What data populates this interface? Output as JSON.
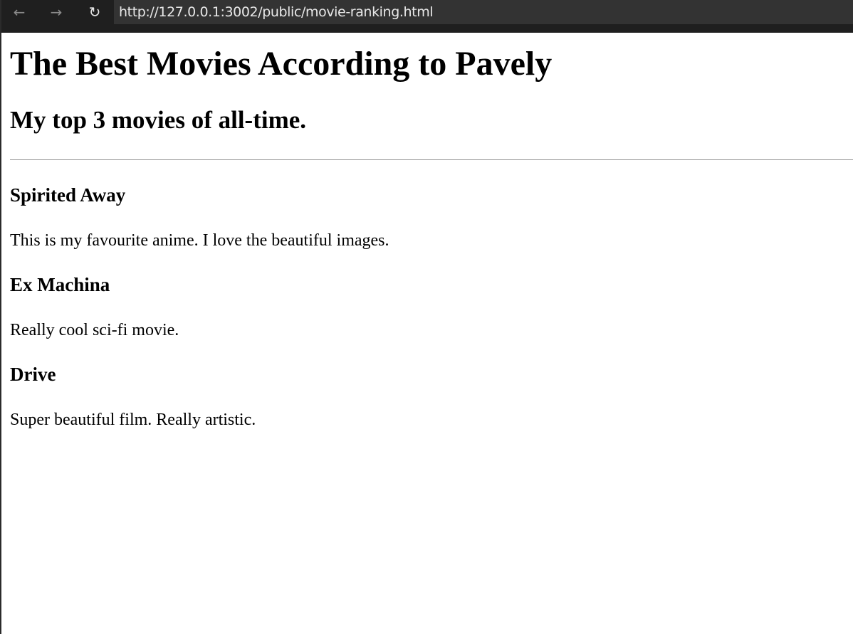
{
  "browser": {
    "url": "http://127.0.0.1:3002/public/movie-ranking.html",
    "back_icon": "arrow-left-icon",
    "forward_icon": "arrow-right-icon",
    "reload_icon": "reload-icon"
  },
  "page": {
    "title": "The Best Movies According to Pavely",
    "subtitle": "My top 3 movies of all-time.",
    "movies": [
      {
        "title": "Spirited Away",
        "description": "This is my favourite anime. I love the beautiful images."
      },
      {
        "title": "Ex Machina",
        "description": "Really cool sci-fi movie."
      },
      {
        "title": "Drive",
        "description": "Super beautiful film. Really artistic."
      }
    ]
  }
}
